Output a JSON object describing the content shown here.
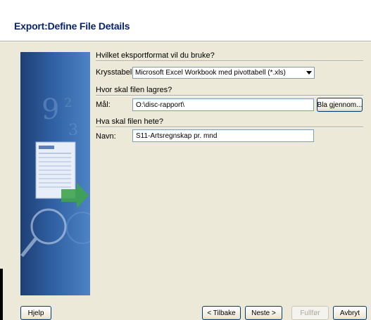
{
  "dialog": {
    "title": "Export:Define File Details"
  },
  "sections": {
    "format_heading": "Hvilket eksportformat vil du bruke?",
    "location_heading": "Hvor skal filen lagres?",
    "name_heading": "Hva skal filen hete?"
  },
  "format": {
    "label": "Krysstabell:",
    "selected": "Microsoft Excel Workbook med pivottabell (*.xls)"
  },
  "location": {
    "label": "Mål:",
    "value": "O:\\disc-rapport\\",
    "browse_label": "Bla gjennom..."
  },
  "file_name": {
    "label": "Navn:",
    "value": "S11-Artsregnskap pr. mnd"
  },
  "buttons": {
    "help": "Hjelp",
    "back": "< Tilbake",
    "next": "Neste >",
    "finish": "Fullfør",
    "cancel": "Avbryt"
  },
  "colors": {
    "title": "#0a246a",
    "dialog_bg": "#ece9d8",
    "art_blue": "#2f5fa2",
    "arrow_green": "#3fa34d"
  }
}
